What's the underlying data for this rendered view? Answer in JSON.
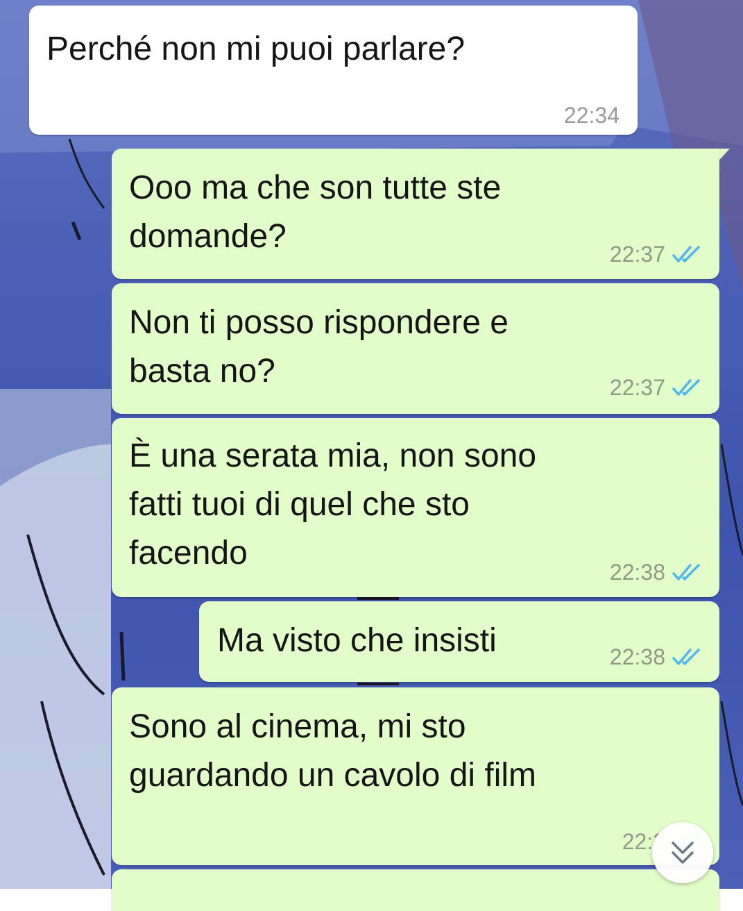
{
  "colors": {
    "incoming_bubble": "#ffffff",
    "outgoing_bubble": "#e2fdc9",
    "read_tick": "#4fb7ec",
    "wallpaper": "#4a5fb5"
  },
  "messages": [
    {
      "direction": "incoming",
      "text": "Perché non mi puoi parlare?",
      "time": "22:34"
    },
    {
      "direction": "outgoing",
      "text": "Ooo ma che son tutte ste\ndomande?",
      "time": "22:37",
      "status": "read"
    },
    {
      "direction": "outgoing",
      "text": "Non ti posso rispondere e\nbasta no?",
      "time": "22:37",
      "status": "read"
    },
    {
      "direction": "outgoing",
      "text": "È una serata mia, non sono\nfatti tuoi di quel che sto\nfacendo",
      "time": "22:38",
      "status": "read"
    },
    {
      "direction": "outgoing",
      "text": "Ma visto che insisti",
      "time": "22:38",
      "status": "read"
    },
    {
      "direction": "outgoing",
      "text": "Sono al cinema, mi sto\nguardando un cavolo di film",
      "time": "22:3",
      "status": "read"
    }
  ],
  "scroll_button": {
    "icon": "double-chevron-down-icon"
  }
}
